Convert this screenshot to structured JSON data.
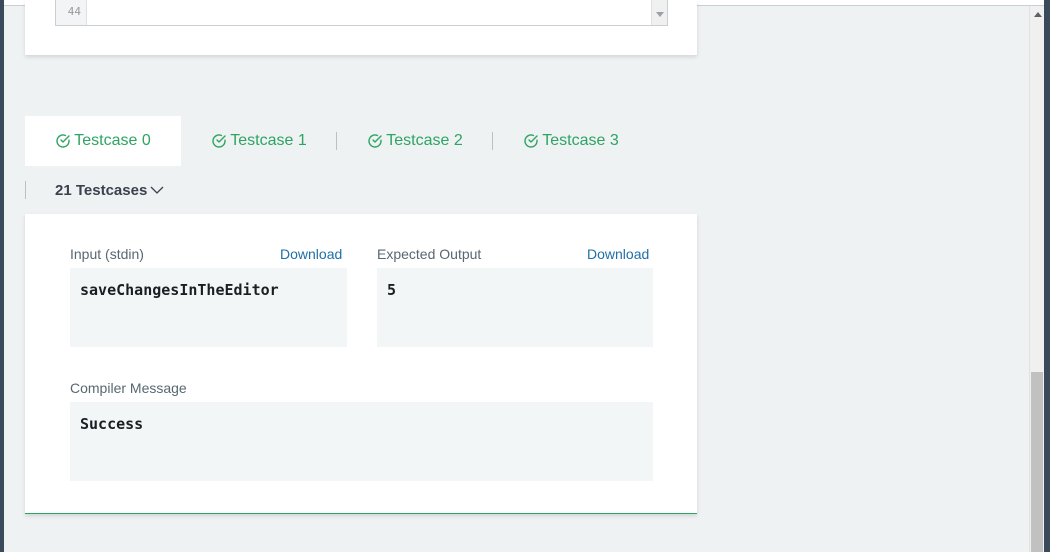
{
  "editor": {
    "line_number": "44"
  },
  "tabs": [
    {
      "label": "Testcase 0",
      "state": "passed",
      "active": true
    },
    {
      "label": "Testcase 1",
      "state": "passed",
      "active": false
    },
    {
      "label": "Testcase 2",
      "state": "passed",
      "active": false
    },
    {
      "label": "Testcase 3",
      "state": "passed",
      "active": false
    }
  ],
  "testcases_dropdown": {
    "label": "21 Testcases"
  },
  "result": {
    "input_label": "Input (stdin)",
    "input_download": "Download",
    "input_value": "saveChangesInTheEditor",
    "expected_label": "Expected Output",
    "expected_download": "Download",
    "expected_value": "5",
    "compiler_label": "Compiler Message",
    "compiler_value": "Success"
  },
  "icons": {
    "tab_status": "check-circle-icon",
    "dropdown": "chevron-down-icon"
  },
  "colors": {
    "accent_green": "#2ea463",
    "link_blue": "#1f6fa8",
    "page_bg": "#eef2f3"
  }
}
